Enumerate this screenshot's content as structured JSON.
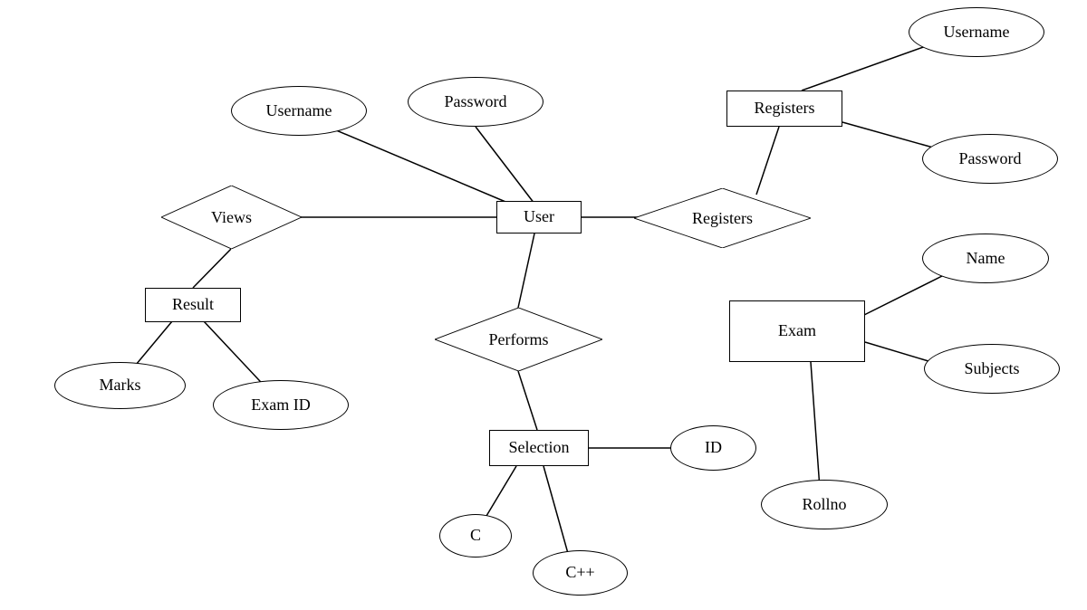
{
  "entities": {
    "user": {
      "label": "User"
    },
    "result": {
      "label": "Result"
    },
    "selection": {
      "label": "Selection"
    },
    "exam": {
      "label": "Exam"
    },
    "registersEntity": {
      "label": "Registers"
    }
  },
  "relationships": {
    "views": {
      "label": "Views"
    },
    "performs": {
      "label": "Performs"
    },
    "registersRel": {
      "label": "Registers"
    }
  },
  "attributes": {
    "user_username": {
      "label": "Username"
    },
    "user_password": {
      "label": "Password"
    },
    "result_marks": {
      "label": "Marks"
    },
    "result_examid": {
      "label": "Exam ID"
    },
    "sel_id": {
      "label": "ID"
    },
    "sel_c": {
      "label": "C"
    },
    "sel_cpp": {
      "label": "C++"
    },
    "exam_name": {
      "label": "Name"
    },
    "exam_subjects": {
      "label": "Subjects"
    },
    "exam_rollno": {
      "label": "Rollno"
    },
    "reg_username": {
      "label": "Username"
    },
    "reg_password": {
      "label": "Password"
    }
  }
}
